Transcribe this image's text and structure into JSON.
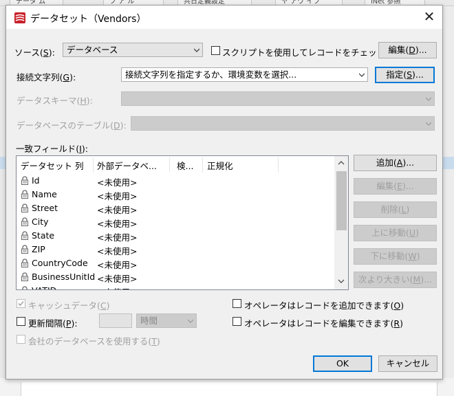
{
  "dialog": {
    "title": "データセット（Vendors）",
    "close_glyph": "✕"
  },
  "background": {
    "tabs": [
      "データ ム",
      "フ ア ル",
      "共日定義設定",
      "ヤ アウ イフ",
      "iNet 参照"
    ]
  },
  "source": {
    "label": "ソース(",
    "key": "S",
    "label_end": "):",
    "value": "データベース"
  },
  "script_checkbox": {
    "label": "スクリプトを使用してレコードをチェック(",
    "key": "E",
    "checked": false
  },
  "edit_button": {
    "label": "編集(",
    "key": "D",
    "end": ")..."
  },
  "connection": {
    "label": "接続文字列(",
    "key": "G",
    "label_end": "):",
    "value": "接続文字列を指定するか、環境変数を選択..."
  },
  "specify_button": {
    "label": "指定(",
    "key": "S",
    "end": ")..."
  },
  "schema": {
    "label": "データスキーマ(",
    "key": "H",
    "end": "):"
  },
  "table": {
    "label": "データベースのテーブル(",
    "key": "D",
    "end": "):"
  },
  "match_fields": {
    "label": "一致フィールド(",
    "key": "I",
    "end": "):"
  },
  "list": {
    "columns": [
      "データセット 列",
      "外部データベ...",
      "検...",
      "正規化"
    ],
    "rows": [
      {
        "name": "Id",
        "value": "<未使用>"
      },
      {
        "name": "Name",
        "value": "<未使用>"
      },
      {
        "name": "Street",
        "value": "<未使用>"
      },
      {
        "name": "City",
        "value": "<未使用>"
      },
      {
        "name": "State",
        "value": "<未使用>"
      },
      {
        "name": "ZIP",
        "value": "<未使用>"
      },
      {
        "name": "CountryCode",
        "value": "<未使用>"
      },
      {
        "name": "BusinessUnitId",
        "value": "<未使用>"
      },
      {
        "name": "VATID",
        "value": "<未使用>"
      }
    ]
  },
  "side_buttons": {
    "add": {
      "label": "追加(",
      "key": "A",
      "end": ")..."
    },
    "edit": {
      "label": "編集(",
      "key": "E",
      "end": ")..."
    },
    "delete": {
      "label": "削除(",
      "key": "L",
      "end": ")"
    },
    "move_up": {
      "label": "上に移動(",
      "key": "U",
      "end": ")"
    },
    "move_down": {
      "label": "下に移動(",
      "key": "W",
      "end": ")"
    },
    "next_larger": {
      "label": "次より大きい(",
      "key": "M",
      "end": ")..."
    }
  },
  "options": {
    "cache": {
      "label": "キャッシュデータ(",
      "key": "C",
      "end": ")",
      "checked": true,
      "disabled": true
    },
    "refresh": {
      "label": "更新間隔(",
      "key": "P",
      "end": "):",
      "checked": false,
      "unit": "時間"
    },
    "company_db": {
      "label": "会社のデータベースを使用する(",
      "key": "T",
      "end": ")",
      "checked": false,
      "disabled": true
    },
    "allow_add": {
      "label": "オペレータはレコードを追加できます(",
      "key": "O",
      "end": ")",
      "checked": false
    },
    "allow_edit": {
      "label": "オペレータはレコードを編集できます(",
      "key": "R",
      "end": ")",
      "checked": false
    }
  },
  "footer": {
    "ok": "OK",
    "cancel": "キャンセル"
  },
  "colors": {
    "accent": "#0078d7",
    "dialog_bg": "#f0f0f0",
    "title_icon": "#c8202b"
  }
}
